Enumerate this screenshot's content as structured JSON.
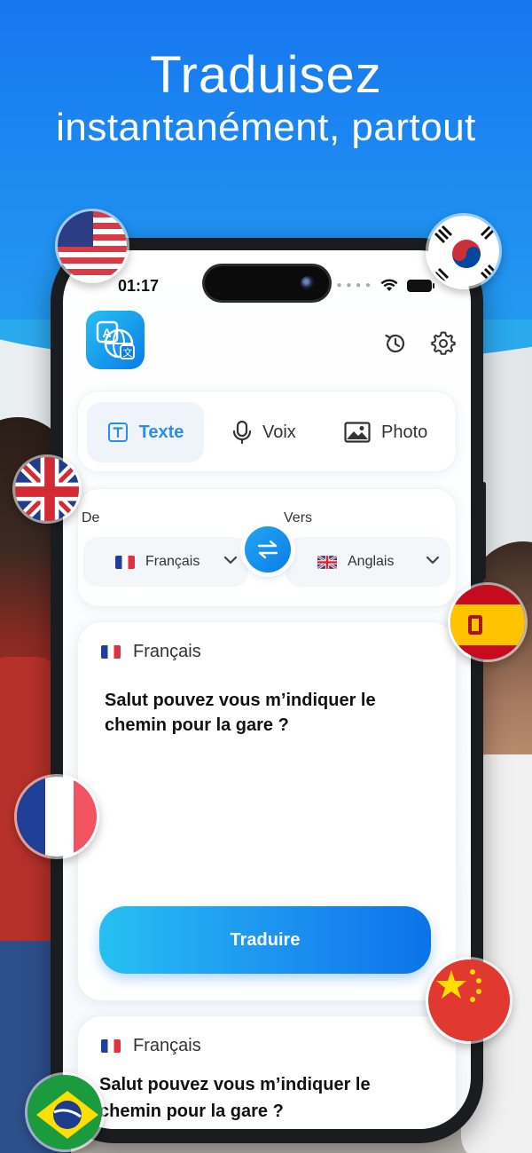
{
  "headline": {
    "line1": "Traduisez",
    "line2": "instantanément, partout"
  },
  "status_bar": {
    "time": "01:17"
  },
  "header": {
    "logo_icon": "translate-globe-icon",
    "history_icon": "history-icon",
    "settings_icon": "gear-icon"
  },
  "tabs": [
    {
      "label": "Texte",
      "icon": "text-icon",
      "active": true
    },
    {
      "label": "Voix",
      "icon": "microphone-icon",
      "active": false
    },
    {
      "label": "Photo",
      "icon": "image-icon",
      "active": false
    }
  ],
  "language_picker": {
    "from_label": "De",
    "to_label": "Vers",
    "from_value": "Français",
    "to_value": "Anglais",
    "swap_icon": "swap-arrows-icon"
  },
  "input_card": {
    "language": "Français",
    "text": "Salut pouvez vous m’indiquer le chemin pour la gare ?",
    "button_label": "Traduire"
  },
  "result_card": {
    "language": "Français",
    "text": "Salut pouvez vous m’indiquer le chemin pour la gare ?"
  },
  "colors": {
    "accent": "#1a8ef0",
    "headline_bg_top": "#1677f0",
    "headline_bg_bottom": "#2ba9ee"
  }
}
